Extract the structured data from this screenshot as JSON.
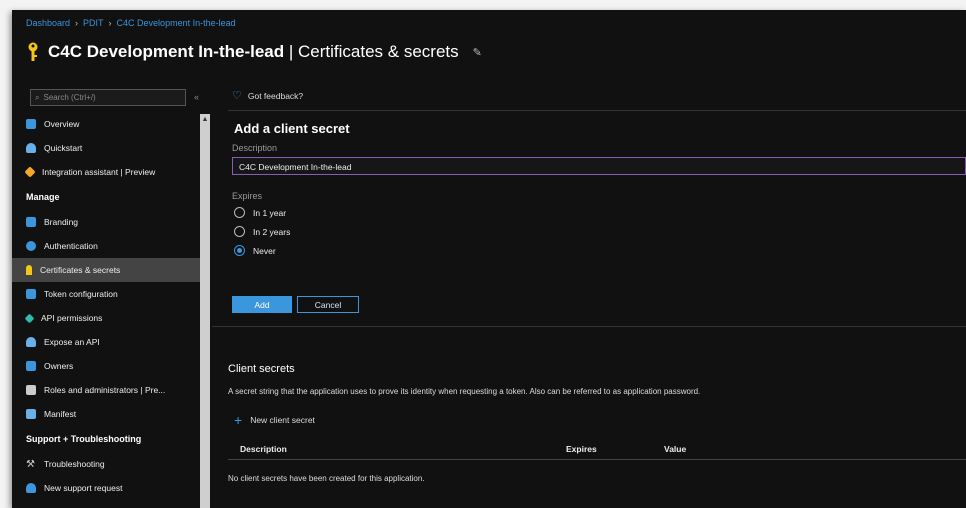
{
  "breadcrumb": [
    "Dashboard",
    "PDIT",
    "C4C Development In-the-lead"
  ],
  "page": {
    "title": "C4C Development In-the-lead",
    "subtitle": "| Certificates & secrets"
  },
  "search": {
    "placeholder": "Search (Ctrl+/)"
  },
  "nav": {
    "items_top": [
      "Overview",
      "Quickstart",
      "Integration assistant | Preview"
    ],
    "manage_label": "Manage",
    "manage_items": [
      "Branding",
      "Authentication",
      "Certificates & secrets",
      "Token configuration",
      "API permissions",
      "Expose an API",
      "Owners",
      "Roles and administrators | Pre...",
      "Manifest"
    ],
    "support_label": "Support + Troubleshooting",
    "support_items": [
      "Troubleshooting",
      "New support request"
    ]
  },
  "feedback": "Got feedback?",
  "add_secret": {
    "heading": "Add a client secret",
    "description_label": "Description",
    "description_value": "C4C Development In-the-lead",
    "expires_label": "Expires",
    "options": [
      "In 1 year",
      "In 2 years",
      "Never"
    ],
    "selected": "Never",
    "add_label": "Add",
    "cancel_label": "Cancel"
  },
  "client_secrets": {
    "heading": "Client secrets",
    "description": "A secret string that the application uses to prove its identity when requesting a token. Also can be referred to as application password.",
    "new_label": "New client secret",
    "columns": [
      "Description",
      "Expires",
      "Value"
    ],
    "empty_message": "No client secrets have been created for this application."
  },
  "colors": {
    "accent": "#3a96dd",
    "key": "#f5c518",
    "background": "#111111",
    "selected": "#444444"
  }
}
